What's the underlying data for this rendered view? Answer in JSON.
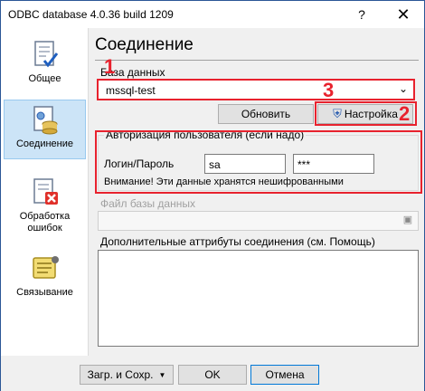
{
  "window": {
    "title": "ODBC database 4.0.36 build 1209",
    "help_glyph": "?",
    "close_glyph": "✕"
  },
  "sidebar": {
    "items": [
      {
        "label": "Общее"
      },
      {
        "label": "Соединение"
      },
      {
        "label": "Обработка ошибок"
      },
      {
        "label": "Связывание"
      }
    ]
  },
  "page": {
    "title": "Соединение"
  },
  "database": {
    "label": "База данных",
    "value": "mssql-test",
    "refresh_label": "Обновить",
    "settings_label": "Настройка"
  },
  "auth": {
    "legend": "Авторизация пользователя (если надо)",
    "login_label": "Логин/Пароль",
    "login_value": "sa",
    "password_value": "***",
    "warning": "Внимание! Эти данные хранятся нешифрованными"
  },
  "dbfile": {
    "label": "Файл базы данных",
    "value": ""
  },
  "extra": {
    "label": "Дополнительные аттрибуты соединения (см. Помощь)",
    "value": ""
  },
  "annotations": {
    "n1": "1",
    "n2": "2",
    "n3": "3"
  },
  "footer": {
    "load_save_label": "Загр. и Сохр.",
    "ok_label": "OK",
    "cancel_label": "Отмена"
  },
  "colors": {
    "annotation_red": "#e8222e",
    "selected_bg": "#cce4f7",
    "accent": "#0078d7"
  }
}
